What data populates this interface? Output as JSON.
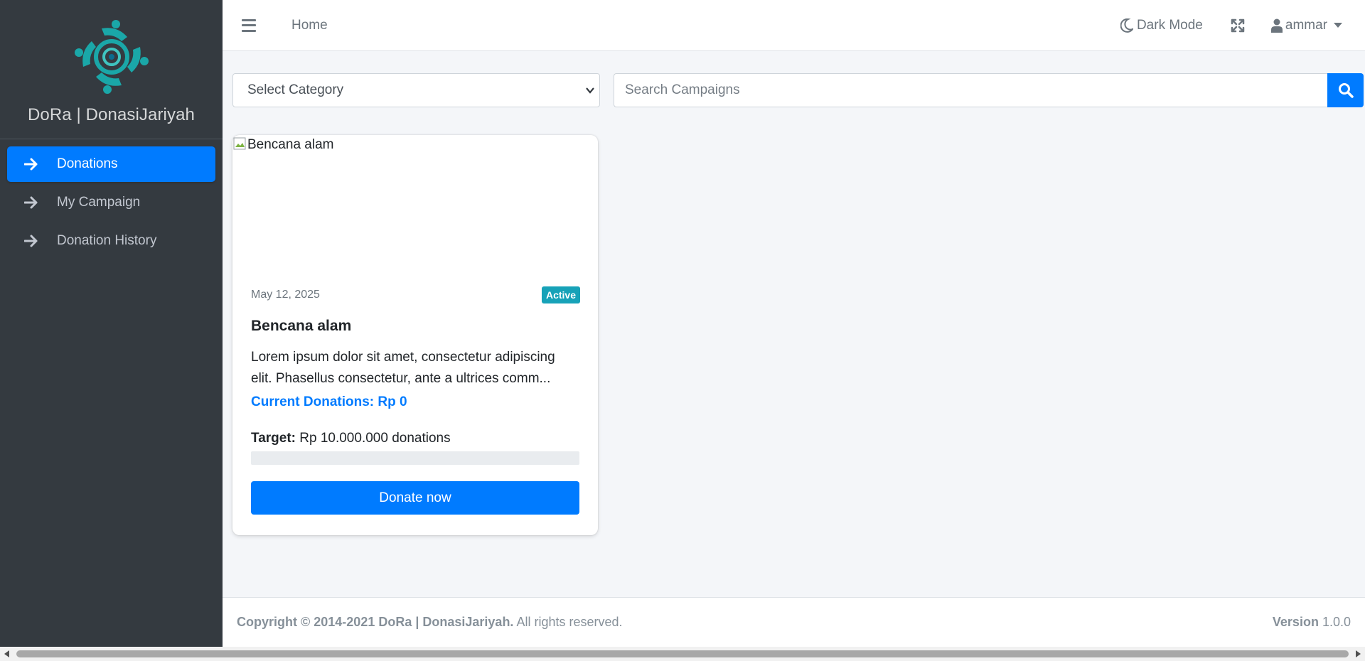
{
  "sidebar": {
    "brand": "DoRa | DonasiJariyah",
    "items": [
      {
        "label": "Donations",
        "active": true
      },
      {
        "label": "My Campaign",
        "active": false
      },
      {
        "label": "Donation History",
        "active": false
      }
    ]
  },
  "topbar": {
    "home": "Home",
    "dark_mode": "Dark Mode",
    "user": "ammar"
  },
  "filters": {
    "category_selected": "Select Category",
    "search_placeholder": "Search Campaigns"
  },
  "campaign": {
    "image_alt": "Bencana alam",
    "date": "May 12, 2025",
    "status": "Active",
    "title": "Bencana alam",
    "description": "Lorem ipsum dolor sit amet, consectetur adipiscing elit. Phasellus consectetur, ante a ultrices comm...",
    "current": "Current Donations: Rp 0",
    "target_label": "Target:",
    "target_value": "Rp 10.000.000 donations",
    "progress_percent": 0,
    "donate_label": "Donate now"
  },
  "footer": {
    "copyright": "Copyright © 2014-2021 DoRa | DonasiJariyah.",
    "rights": "All rights reserved.",
    "version_label": "Version",
    "version": "1.0.0"
  },
  "colors": {
    "primary": "#007bff",
    "sidebar_bg": "#343a40",
    "badge_info": "#17a2b8",
    "logo_teal": "#1aa7a8"
  }
}
